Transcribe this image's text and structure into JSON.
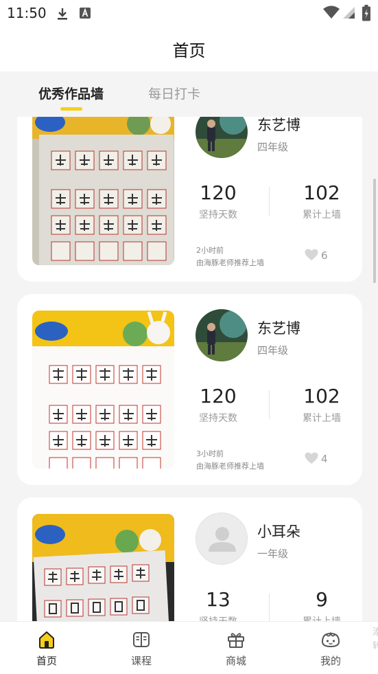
{
  "status_bar": {
    "time": "11:50"
  },
  "header": {
    "title": "首页"
  },
  "tabs": [
    {
      "label": "优秀作品墙",
      "active": true
    },
    {
      "label": "每日打卡",
      "active": false
    }
  ],
  "posts": [
    {
      "name": "东艺博",
      "grade": "四年级",
      "days": "120",
      "days_label": "坚持天数",
      "total": "102",
      "total_label": "累计上墙",
      "time_ago": "2小时前",
      "recommended_by": "由海豚老师推荐上墙",
      "likes": "6",
      "avatar": "photo"
    },
    {
      "name": "东艺博",
      "grade": "四年级",
      "days": "120",
      "days_label": "坚持天数",
      "total": "102",
      "total_label": "累计上墙",
      "time_ago": "3小时前",
      "recommended_by": "由海豚老师推荐上墙",
      "likes": "4",
      "avatar": "photo"
    },
    {
      "name": "小耳朵",
      "grade": "一年级",
      "days": "13",
      "days_label": "坚持天数",
      "total": "9",
      "total_label": "累计上墙",
      "avatar": "placeholder"
    }
  ],
  "bottom_nav": [
    {
      "label": "首页",
      "icon": "home-icon",
      "active": true
    },
    {
      "label": "课程",
      "icon": "book-icon",
      "active": false
    },
    {
      "label": "商城",
      "icon": "gift-icon",
      "active": false
    },
    {
      "label": "我的",
      "icon": "face-icon",
      "active": false
    }
  ],
  "edge_text": "添 转",
  "colors": {
    "accent": "#f7cf1a",
    "background": "#f4f4f5"
  }
}
